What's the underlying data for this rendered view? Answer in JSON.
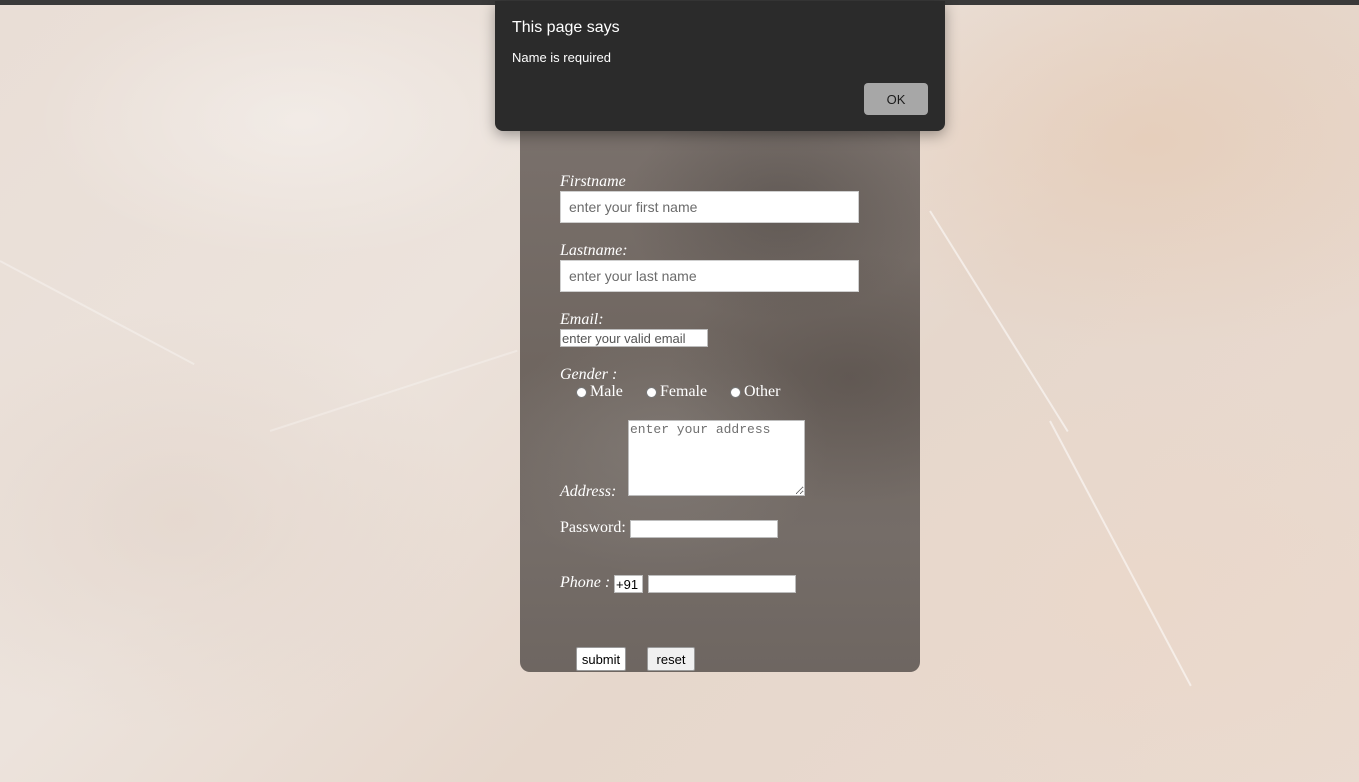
{
  "dialog": {
    "title": "This page says",
    "message": "Name is required",
    "ok_label": "OK"
  },
  "form": {
    "firstname": {
      "label": "Firstname",
      "placeholder": "enter your first name"
    },
    "lastname": {
      "label": "Lastname:",
      "placeholder": "enter your last name"
    },
    "email": {
      "label": "Email:",
      "placeholder": "enter your valid email"
    },
    "gender": {
      "label": "Gender :",
      "options": [
        "Male",
        "Female",
        "Other"
      ]
    },
    "address": {
      "label": "Address:",
      "placeholder": "enter your address"
    },
    "password": {
      "label": "Password:"
    },
    "phone": {
      "label": "Phone :",
      "code_value": "+91"
    },
    "submit_label": "submit",
    "reset_label": "reset"
  }
}
